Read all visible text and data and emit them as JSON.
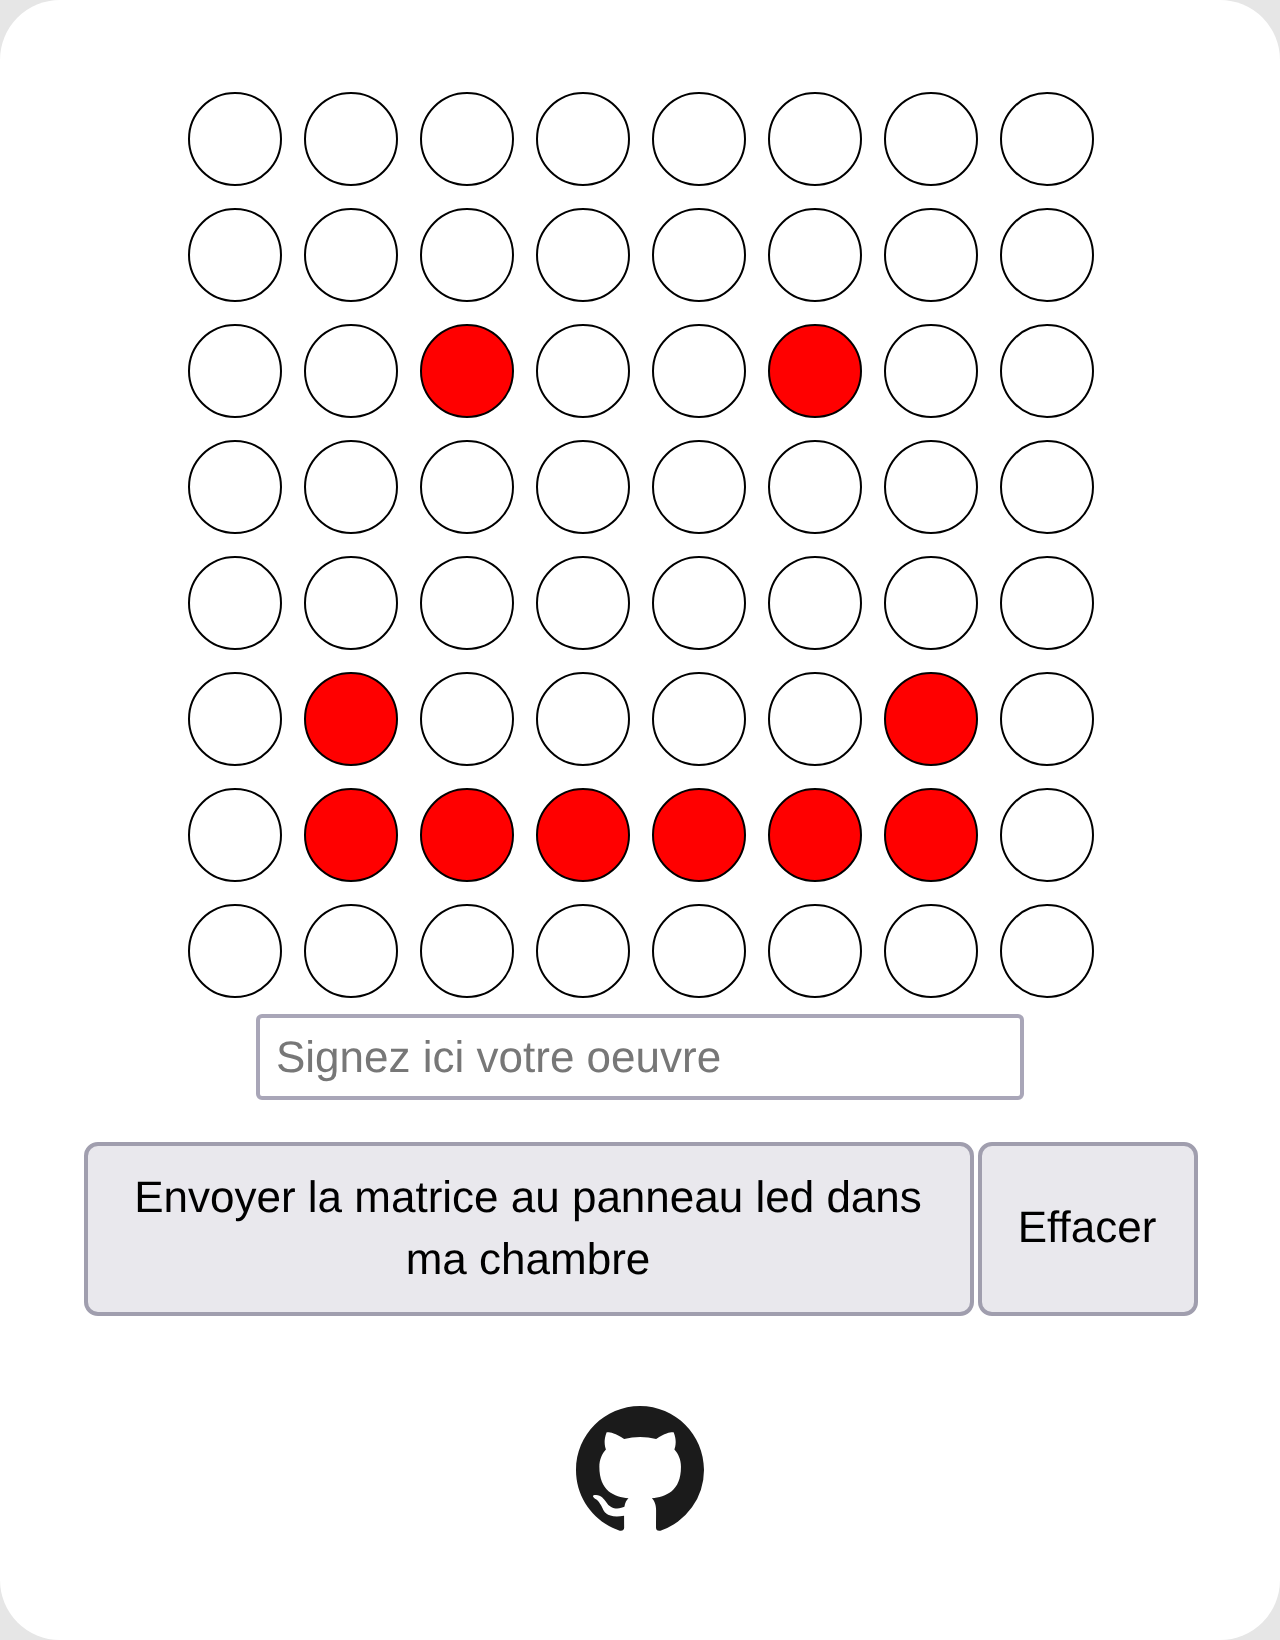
{
  "matrix": {
    "rows": [
      {
        "cells": [
          {
            "on": false
          },
          {
            "on": false
          },
          {
            "on": false
          },
          {
            "on": false
          },
          {
            "on": false
          },
          {
            "on": false
          },
          {
            "on": false
          },
          {
            "on": false
          }
        ]
      },
      {
        "cells": [
          {
            "on": false
          },
          {
            "on": false
          },
          {
            "on": false
          },
          {
            "on": false
          },
          {
            "on": false
          },
          {
            "on": false
          },
          {
            "on": false
          },
          {
            "on": false
          }
        ]
      },
      {
        "cells": [
          {
            "on": false
          },
          {
            "on": false
          },
          {
            "on": true
          },
          {
            "on": false
          },
          {
            "on": false
          },
          {
            "on": true
          },
          {
            "on": false
          },
          {
            "on": false
          }
        ]
      },
      {
        "cells": [
          {
            "on": false
          },
          {
            "on": false
          },
          {
            "on": false
          },
          {
            "on": false
          },
          {
            "on": false
          },
          {
            "on": false
          },
          {
            "on": false
          },
          {
            "on": false
          }
        ]
      },
      {
        "cells": [
          {
            "on": false
          },
          {
            "on": false
          },
          {
            "on": false
          },
          {
            "on": false
          },
          {
            "on": false
          },
          {
            "on": false
          },
          {
            "on": false
          },
          {
            "on": false
          }
        ]
      },
      {
        "cells": [
          {
            "on": false
          },
          {
            "on": true
          },
          {
            "on": false
          },
          {
            "on": false
          },
          {
            "on": false
          },
          {
            "on": false
          },
          {
            "on": true
          },
          {
            "on": false
          }
        ]
      },
      {
        "cells": [
          {
            "on": false
          },
          {
            "on": true
          },
          {
            "on": true
          },
          {
            "on": true
          },
          {
            "on": true
          },
          {
            "on": true
          },
          {
            "on": true
          },
          {
            "on": false
          }
        ]
      },
      {
        "cells": [
          {
            "on": false
          },
          {
            "on": false
          },
          {
            "on": false
          },
          {
            "on": false
          },
          {
            "on": false
          },
          {
            "on": false
          },
          {
            "on": false
          },
          {
            "on": false
          }
        ]
      }
    ]
  },
  "signature": {
    "placeholder": "Signez ici votre oeuvre"
  },
  "buttons": [
    {
      "label": "Envoyer la matrice au panneau led dans ma chambre",
      "kind": "send"
    },
    {
      "label": "Effacer",
      "kind": "clear"
    }
  ]
}
